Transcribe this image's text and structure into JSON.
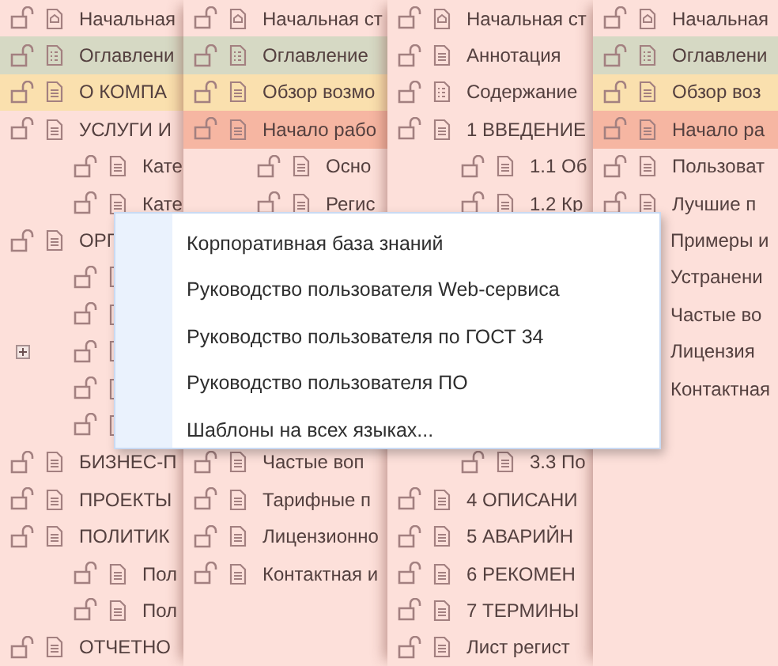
{
  "panels": [
    {
      "rows": [
        {
          "text": "Начальная",
          "kind": "home",
          "locked": false
        },
        {
          "text": "Оглавлени",
          "kind": "toc",
          "color": "#d6d9c4",
          "locked": false
        },
        {
          "text": "О КОМПА",
          "kind": "page",
          "color": "#fae0ae",
          "locked": false
        },
        {
          "text": "УСЛУГИ И",
          "kind": "page",
          "locked": false,
          "children": [
            {
              "text": "Кате",
              "locked": false
            },
            {
              "text": "Кате",
              "locked": false
            }
          ]
        },
        {
          "text": "ОРГ",
          "kind": "page",
          "locked": false,
          "children": [
            {
              "locked": false
            },
            {
              "locked": false
            },
            {
              "expanded": false,
              "locked": false
            },
            {
              "locked": false
            },
            {
              "locked": false
            }
          ]
        },
        {
          "text": "БИЗНЕС-П",
          "kind": "page",
          "locked": false
        },
        {
          "text": "ПРОЕКТЫ",
          "kind": "page",
          "locked": false
        },
        {
          "text": "ПОЛИТИК",
          "kind": "page",
          "locked": false,
          "children": [
            {
              "text": "Пол",
              "locked": false
            },
            {
              "text": "Пол",
              "locked": false
            }
          ]
        },
        {
          "text": "ОТЧЕТНО",
          "kind": "page",
          "locked": false
        }
      ]
    },
    {
      "rows": [
        {
          "text": "Начальная ст",
          "kind": "home",
          "locked": false
        },
        {
          "text": "Оглавление",
          "kind": "toc",
          "color": "#d6d9c4",
          "locked": false
        },
        {
          "text": "Обзор возмо",
          "kind": "page",
          "color": "#fae0ae",
          "locked": false
        },
        {
          "text": "Начало рабо",
          "kind": "page",
          "color": "#f6b6a2",
          "locked": false,
          "children": [
            {
              "text": "Осно",
              "locked": false
            },
            {
              "text": "Регис",
              "locked": false
            }
          ]
        }
      ],
      "rows_below_menu": [
        {
          "text": "Частые воп",
          "kind": "page",
          "locked": false
        },
        {
          "text": "Тарифные п",
          "kind": "page",
          "locked": false
        },
        {
          "text": "Лицензионно",
          "kind": "page",
          "locked": false
        },
        {
          "text": "Контактная и",
          "kind": "page",
          "locked": false
        }
      ]
    },
    {
      "rows": [
        {
          "text": "Начальная ст",
          "kind": "home",
          "locked": false
        },
        {
          "text": "Аннотация",
          "kind": "page",
          "locked": false
        },
        {
          "text": "Содержание",
          "kind": "toc",
          "locked": false
        },
        {
          "text": "1 ВВЕДЕНИЕ",
          "kind": "page",
          "locked": false,
          "children": [
            {
              "text": "1.1 Об",
              "locked": false
            },
            {
              "text": "1.2 Кр",
              "locked": false
            }
          ]
        }
      ],
      "rows_below_menu": [
        {
          "kind": "covered",
          "children": [
            {
              "text": "3.3 По",
              "locked": false
            }
          ]
        },
        {
          "text": "4 ОПИСАНИ",
          "kind": "page",
          "locked": false
        },
        {
          "text": "5 АВАРИЙН",
          "kind": "page",
          "locked": false
        },
        {
          "text": "6 РЕКОМЕН",
          "kind": "page",
          "locked": false
        },
        {
          "text": "7 ТЕРМИНЫ",
          "kind": "page",
          "locked": false
        },
        {
          "text": "Лист регист",
          "kind": "page",
          "locked": false
        }
      ]
    },
    {
      "rows": [
        {
          "text": "Начальная",
          "kind": "home",
          "locked": false
        },
        {
          "text": "Оглавлени",
          "kind": "toc",
          "color": "#d6d9c4",
          "locked": false
        },
        {
          "text": "Обзор воз",
          "kind": "page",
          "color": "#fae0ae",
          "locked": false
        },
        {
          "text": "Начало ра",
          "kind": "page",
          "color": "#f6b6a2",
          "locked": false
        },
        {
          "text": "Пользоват",
          "kind": "page",
          "locked": false
        },
        {
          "text": "Лучшие п",
          "kind": "page",
          "locked": false
        },
        {
          "text": "Примеры и",
          "kind": "text-only"
        },
        {
          "text": "Устранени",
          "kind": "text-only"
        },
        {
          "text": "Частые во",
          "kind": "text-only"
        },
        {
          "text": "Лицензия",
          "kind": "text-only"
        },
        {
          "text": "Контактная",
          "kind": "text-only"
        }
      ]
    }
  ],
  "menu": {
    "items": [
      "Корпоративная база знаний",
      "Руководство пользователя Web-сервиса",
      "Руководство пользователя по ГОСТ 34",
      "Руководство пользователя ПО",
      "Шаблоны на всех языках..."
    ]
  }
}
